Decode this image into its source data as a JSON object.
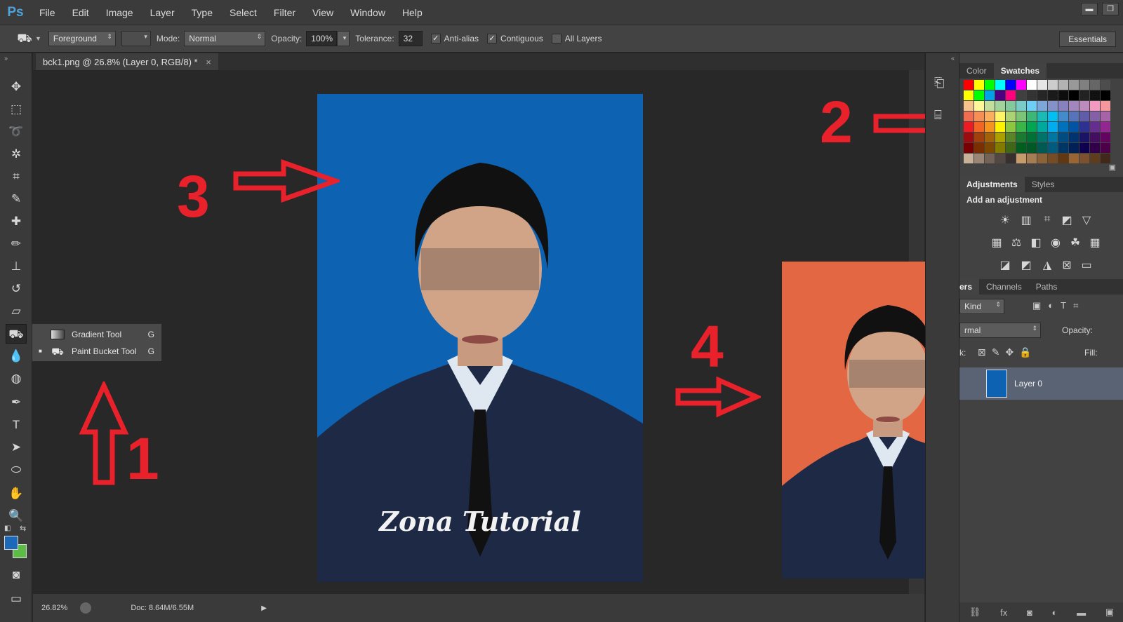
{
  "app": {
    "logo": "Ps",
    "menu": [
      "File",
      "Edit",
      "Image",
      "Layer",
      "Type",
      "Select",
      "Filter",
      "View",
      "Window",
      "Help"
    ],
    "window_controls": {
      "minimize": "▬",
      "restore": "❐"
    }
  },
  "options_bar": {
    "fill_source": "Foreground",
    "mode_label": "Mode:",
    "mode_value": "Normal",
    "opacity_label": "Opacity:",
    "opacity_value": "100%",
    "tolerance_label": "Tolerance:",
    "tolerance_value": "32",
    "anti_alias_label": "Anti-alias",
    "anti_alias_checked": true,
    "contiguous_label": "Contiguous",
    "contiguous_checked": true,
    "all_layers_label": "All Layers",
    "all_layers_checked": false,
    "workspace": "Essentials"
  },
  "document": {
    "tab_title": "bck1.png @ 26.8% (Layer 0, RGB/8) *",
    "close_glyph": "×"
  },
  "status_bar": {
    "zoom": "26.82%",
    "doc_size": "Doc: 8.64M/6.55M"
  },
  "tool_flyout": {
    "items": [
      {
        "label": "Gradient Tool",
        "shortcut": "G",
        "selected": false
      },
      {
        "label": "Paint Bucket Tool",
        "shortcut": "G",
        "selected": true
      }
    ]
  },
  "colors": {
    "foreground": "#1b69b8",
    "background": "#5cbc47",
    "photo_before_bg": "#0d62b1",
    "photo_after_bg": "#e46744",
    "annotation_red": "#e8212a"
  },
  "annotations": {
    "step1": "1",
    "step2": "2",
    "step3": "3",
    "step4": "4"
  },
  "watermark": "Zona Tutorial",
  "panels": {
    "color_tabs": [
      "Color",
      "Swatches"
    ],
    "active_color_tab": "Swatches",
    "adjust_tabs": [
      "Adjustments",
      "Styles"
    ],
    "adjust_heading": "Add an adjustment",
    "layers_tabs": [
      "ers",
      "Channels",
      "Paths"
    ],
    "kind_label": "Kind",
    "blend_mode": "rmal",
    "opacity_label": "Opacity:",
    "lock_label": "k:",
    "fill_label": "Fill:",
    "layer_name": "Layer 0"
  }
}
